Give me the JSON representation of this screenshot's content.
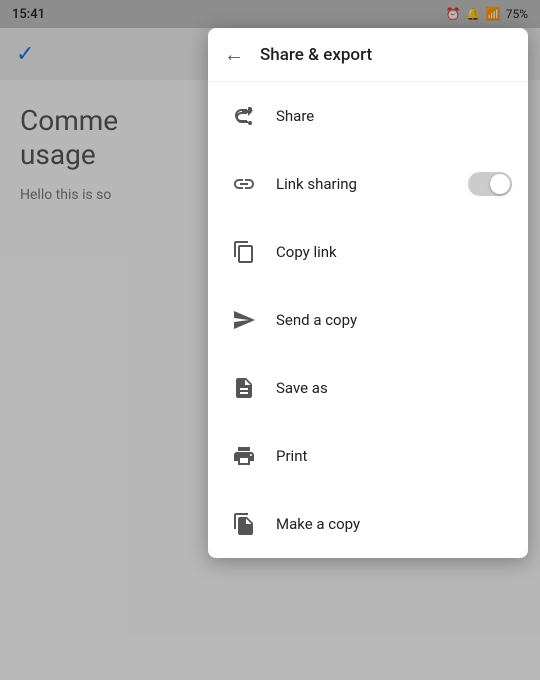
{
  "statusBar": {
    "time": "15:41",
    "battery": "75%",
    "icons": "⏰ 🔔 📶 🔋"
  },
  "appContent": {
    "title": "Comme\nusage",
    "subtitle": "Hello this is so"
  },
  "menu": {
    "header": {
      "title": "Share & export",
      "backIcon": "←"
    },
    "items": [
      {
        "id": "share",
        "label": "Share"
      },
      {
        "id": "link-sharing",
        "label": "Link sharing",
        "hasToggle": true,
        "toggleOn": false
      },
      {
        "id": "copy-link",
        "label": "Copy link"
      },
      {
        "id": "send-a-copy",
        "label": "Send a copy"
      },
      {
        "id": "save-as",
        "label": "Save as"
      },
      {
        "id": "print",
        "label": "Print"
      },
      {
        "id": "make-a-copy",
        "label": "Make a copy"
      }
    ]
  }
}
